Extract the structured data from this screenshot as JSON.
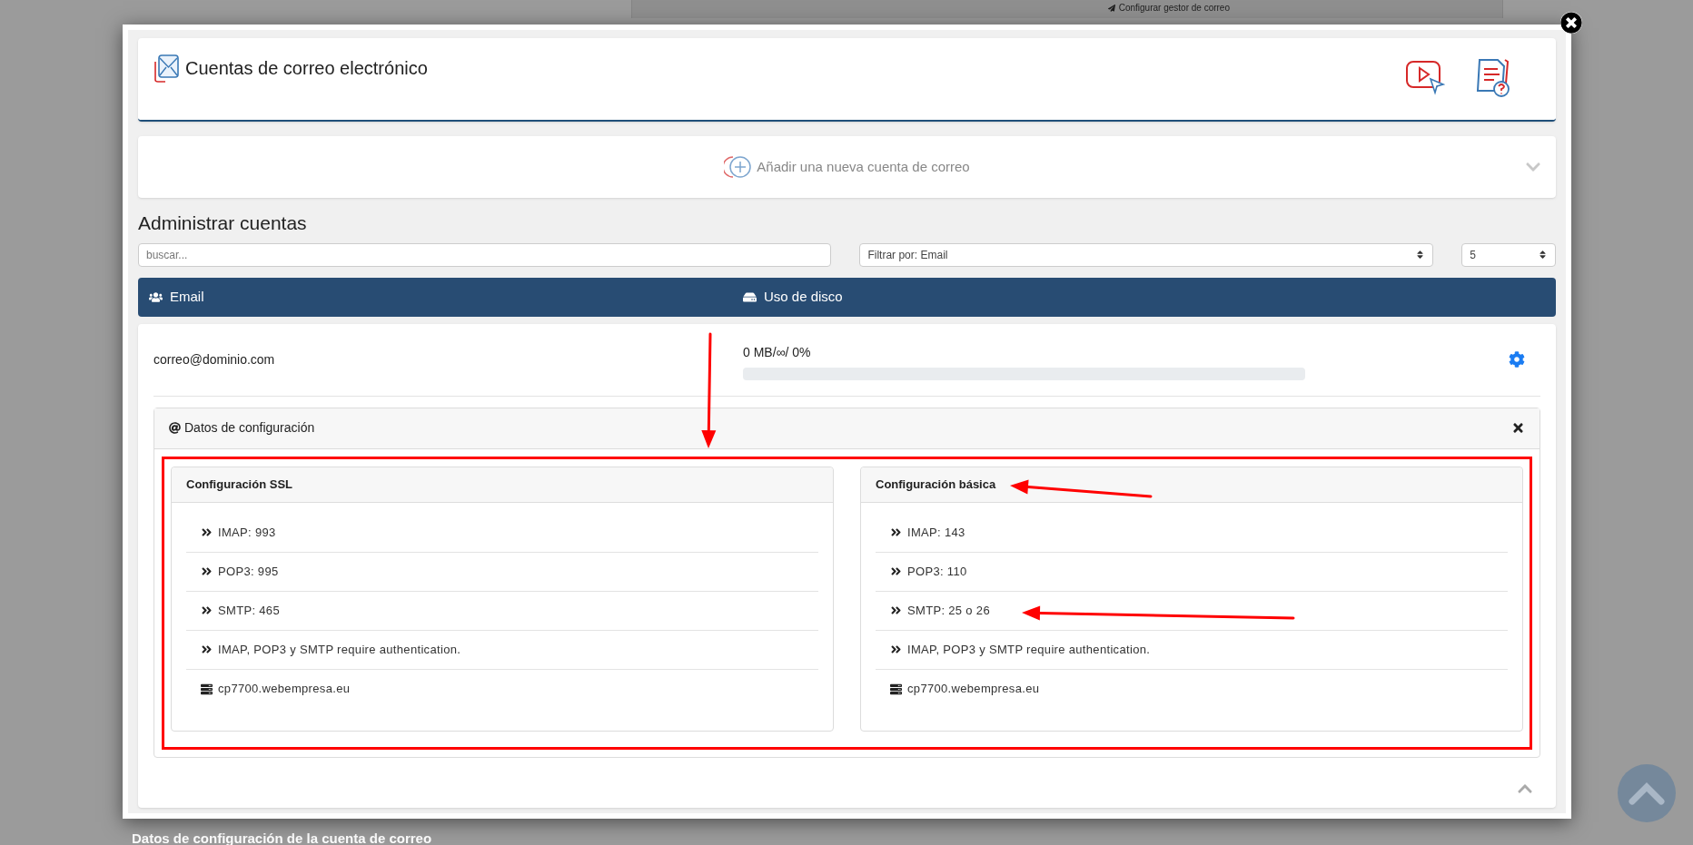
{
  "background_page": {
    "link": "Configurar gestor de correo",
    "heading": "Datos de configuración de la cuenta de correo"
  },
  "modal": {
    "title": "Cuentas de correo electrónico",
    "add_account": {
      "label": "Añadir una nueva cuenta de correo",
      "expanded": false
    },
    "section_title": "Administrar cuentas",
    "search": {
      "placeholder": "buscar..."
    },
    "filter": {
      "value": "Filtrar por: Email"
    },
    "page_size": {
      "value": "5"
    },
    "table": {
      "columns": [
        "Email",
        "Uso de disco"
      ],
      "rows": [
        {
          "email": "correo@dominio.com",
          "usage": "0 MB/∞/ 0%",
          "level": 0,
          "expanded": true,
          "details": {
            "title": "Datos de configuración",
            "panels": [
              {
                "title": "Configuración SSL",
                "items": [
                  {
                    "kind": "port",
                    "text": "IMAP: 993"
                  },
                  {
                    "kind": "port",
                    "text": "POP3: 995"
                  },
                  {
                    "kind": "port",
                    "text": "SMTP: 465"
                  },
                  {
                    "kind": "port",
                    "text": "IMAP, POP3 y SMTP require authentication."
                  },
                  {
                    "kind": "server",
                    "text": "cp7700.webempresa.eu"
                  }
                ]
              },
              {
                "title": "Configuración básica",
                "items": [
                  {
                    "kind": "port",
                    "text": "IMAP: 143"
                  },
                  {
                    "kind": "port",
                    "text": "POP3: 110"
                  },
                  {
                    "kind": "port",
                    "text": "SMTP: 25 o 26"
                  },
                  {
                    "kind": "port",
                    "text": "IMAP, POP3 y SMTP require authentication."
                  },
                  {
                    "kind": "server",
                    "text": "cp7700.webempresa.eu"
                  }
                ]
              }
            ]
          }
        }
      ]
    }
  }
}
